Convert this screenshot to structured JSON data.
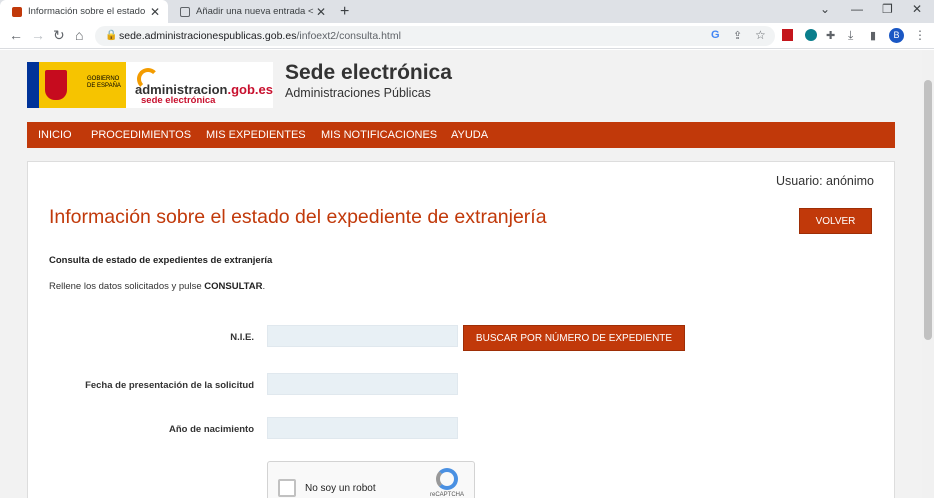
{
  "browser": {
    "tabs": [
      {
        "title": "Información sobre el estado del exp"
      },
      {
        "title": "Añadir una nueva entrada < Abo"
      }
    ],
    "new_tab_icon": "plus-icon",
    "url_host": "sede.administracionespublicas.gob.es",
    "url_path": "/infoext2/consulta.html",
    "profile_initial": "B"
  },
  "header": {
    "gobierno_text": "GOBIERNO DE ESPAÑA",
    "adm_name_1": "administracion",
    "adm_name_2": ".gob.es",
    "adm_sub": "sede electrónica",
    "site_title": "Sede electrónica",
    "site_subtitle": "Administraciones Públicas"
  },
  "menu": {
    "items": [
      "INICIO",
      "PROCEDIMIENTOS",
      "MIS EXPEDIENTES",
      "MIS NOTIFICACIONES",
      "AYUDA"
    ]
  },
  "panel": {
    "user": "Usuario: anónimo",
    "title": "Información sobre el estado del expediente de extranjería",
    "back_button": "VOLVER",
    "section_heading": "Consulta de estado de expedientes de extranjería",
    "instructions": "Rellene los datos solicitados y pulse ",
    "instructions_bold": "CONSULTAR",
    "instructions_end": ".",
    "fields": {
      "nie_label": "N.I.E.",
      "fecha_label": "Fecha de presentación de la solicitud",
      "anio_label": "Año de nacimiento"
    },
    "search_button": "BUSCAR POR NÚMERO DE EXPEDIENTE",
    "captcha_label": "No soy un robot",
    "captcha_brand": "reCAPTCHA"
  },
  "colors": {
    "accent": "#c1390a",
    "field_bg": "#e8f0f5"
  }
}
